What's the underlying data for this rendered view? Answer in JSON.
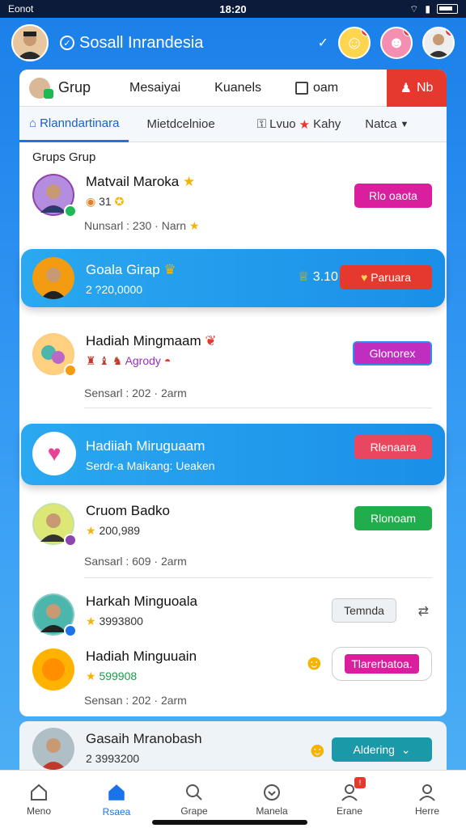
{
  "status": {
    "carrier": "Eonot",
    "time": "18:20"
  },
  "app": {
    "title": "Sosall Inrandesia"
  },
  "tabs1": [
    "Grup",
    "Mesaiyai",
    "Kuanels",
    "oam",
    "Nb"
  ],
  "tabs2": [
    "Rlanndartinara",
    "Mietdcelnioe",
    "Lvuo",
    "Kahy",
    "Natca"
  ],
  "section": "Grups Grup",
  "rows": [
    {
      "name": "Matvail Maroka",
      "sub": "31",
      "meta": "Nunsarl : 230 · Narn",
      "btn": "Rlo oaota",
      "btn_color": "#d91f9e"
    },
    {
      "name": "Goala Girap",
      "sub": "2 ?20,0000",
      "score": "3.10",
      "btn": "Paruara",
      "btn_color": "#e5392f"
    },
    {
      "name": "Hadiah Mingmaam",
      "sub": "Agrody",
      "meta": "Sensarl : 202 · 2arm",
      "btn": "Glonorex",
      "btn_color": "#c02ec0"
    },
    {
      "name": "Hadiiah Miruguaam",
      "sub": "Serdr-a Maikang: Ueaken",
      "btn": "Rlenaara",
      "btn_color": "#e8475f"
    },
    {
      "name": "Cruom Badko",
      "sub": "200,989",
      "meta": "Sansarl : 609 · 2arm",
      "btn": "Rlonoam",
      "btn_color": "#1fae4b"
    },
    {
      "name": "Harkah Minguoala",
      "sub": "3993800",
      "btn": "Temnda",
      "btn_color": "#eef1f4"
    },
    {
      "name": "Hadiah Minguuain",
      "sub": "599908",
      "meta": "Sensan : 202 · 2arm",
      "btn": "Tlarerbatoa.",
      "btn_color": "#d91f9e"
    },
    {
      "name": "Gasaih Mranobash",
      "sub": "2 3993200",
      "btn": "Aldering",
      "btn_color": "#1a9aa8"
    }
  ],
  "nav": [
    "Meno",
    "Rsaea",
    "Grape",
    "Manela",
    "Erane",
    "Herre"
  ]
}
